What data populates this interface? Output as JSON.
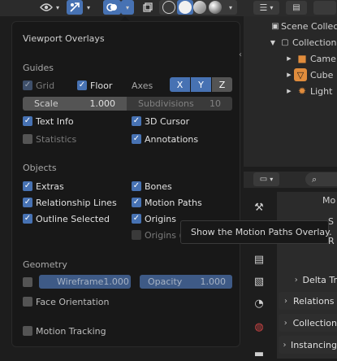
{
  "header": {
    "icons": [
      "visibility-icon",
      "gizmo-icon",
      "overlays-icon",
      "xray-icon",
      "wireframe-shading-icon",
      "solid-shading-icon",
      "material-shading-icon",
      "rendered-shading-icon"
    ]
  },
  "overlays": {
    "title": "Viewport Overlays",
    "guides": {
      "heading": "Guides",
      "grid": "Grid",
      "floor": "Floor",
      "axes_label": "Axes",
      "axes": [
        "X",
        "Y",
        "Z"
      ],
      "scale_label": "Scale",
      "scale_value": "1.000",
      "subdiv_label": "Subdivisions",
      "subdiv_value": "10",
      "text_info": "Text Info",
      "cursor_3d": "3D Cursor",
      "statistics": "Statistics",
      "annotations": "Annotations"
    },
    "objects": {
      "heading": "Objects",
      "extras": "Extras",
      "bones": "Bones",
      "relationship_lines": "Relationship Lines",
      "motion_paths": "Motion Paths",
      "outline_selected": "Outline Selected",
      "origins": "Origins",
      "origins_all": "Origins (A"
    },
    "geometry": {
      "heading": "Geometry",
      "wireframe_label": "Wireframe",
      "wireframe_value": "1.000",
      "opacity_label": "Opacity",
      "opacity_value": "1.000",
      "face_orientation": "Face Orientation"
    },
    "motion_tracking": "Motion Tracking"
  },
  "tooltip": "Show the Motion Paths Overlay.",
  "outliner": {
    "scene_collection": "Scene Collect",
    "collection": "Collection",
    "items": [
      "Came",
      "Cube",
      "Light"
    ]
  },
  "properties": {
    "partial_labels": [
      "Mo",
      "S",
      "R"
    ],
    "panels": [
      "Delta Tr",
      "Relations",
      "Collection",
      "Instancing"
    ]
  },
  "colors": {
    "accent": "#4772b3",
    "panel_bg": "#181818",
    "header_bg": "#2b2b2b"
  }
}
